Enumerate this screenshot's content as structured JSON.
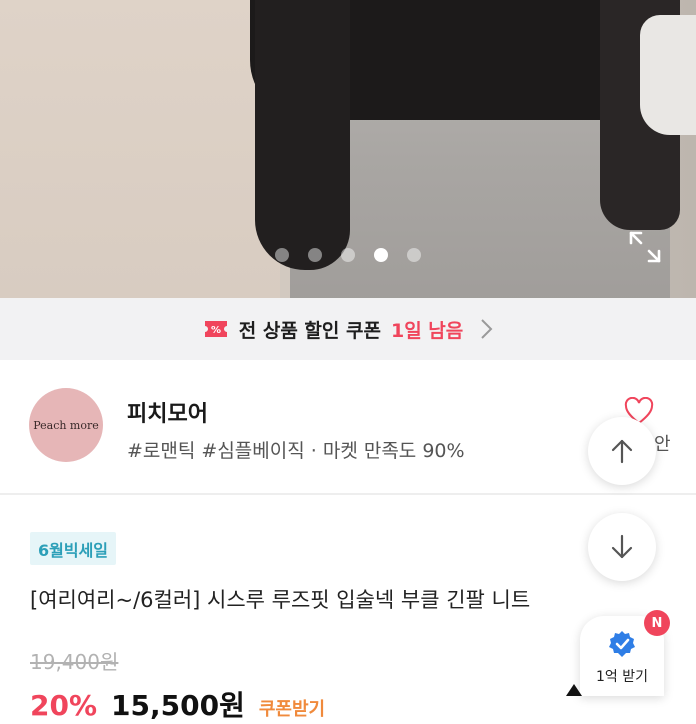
{
  "hero": {
    "slide_count": 5,
    "active_slide": 4
  },
  "coupon": {
    "text": "전 상품 할인 쿠폰",
    "highlight": "1일 남음",
    "accent_color": "#f0455c"
  },
  "shop": {
    "logo_text": "Peach more",
    "name": "피치모어",
    "tags": "#로맨틱 #심플베이직 · 마켓 만족도 90%",
    "like_count_partial": "안"
  },
  "product": {
    "badge": "6월빅세일",
    "title": "[여리여리~/6컬러] 시스루 루즈핏 입술넥 부클 긴팔 니트",
    "original_price": "19,400원",
    "discount": "20%",
    "sale_price": "15,500원",
    "price_tag": "쿠폰받기"
  },
  "floating": {
    "reward_label": "1억 받기",
    "new_badge": "N"
  },
  "icons": {
    "expand": "expand-icon",
    "coupon": "coupon-ticket-icon",
    "chevron": "chevron-right-icon",
    "heart": "heart-icon",
    "up": "arrow-up-icon",
    "down": "arrow-down-icon",
    "reward": "verified-badge-icon"
  }
}
